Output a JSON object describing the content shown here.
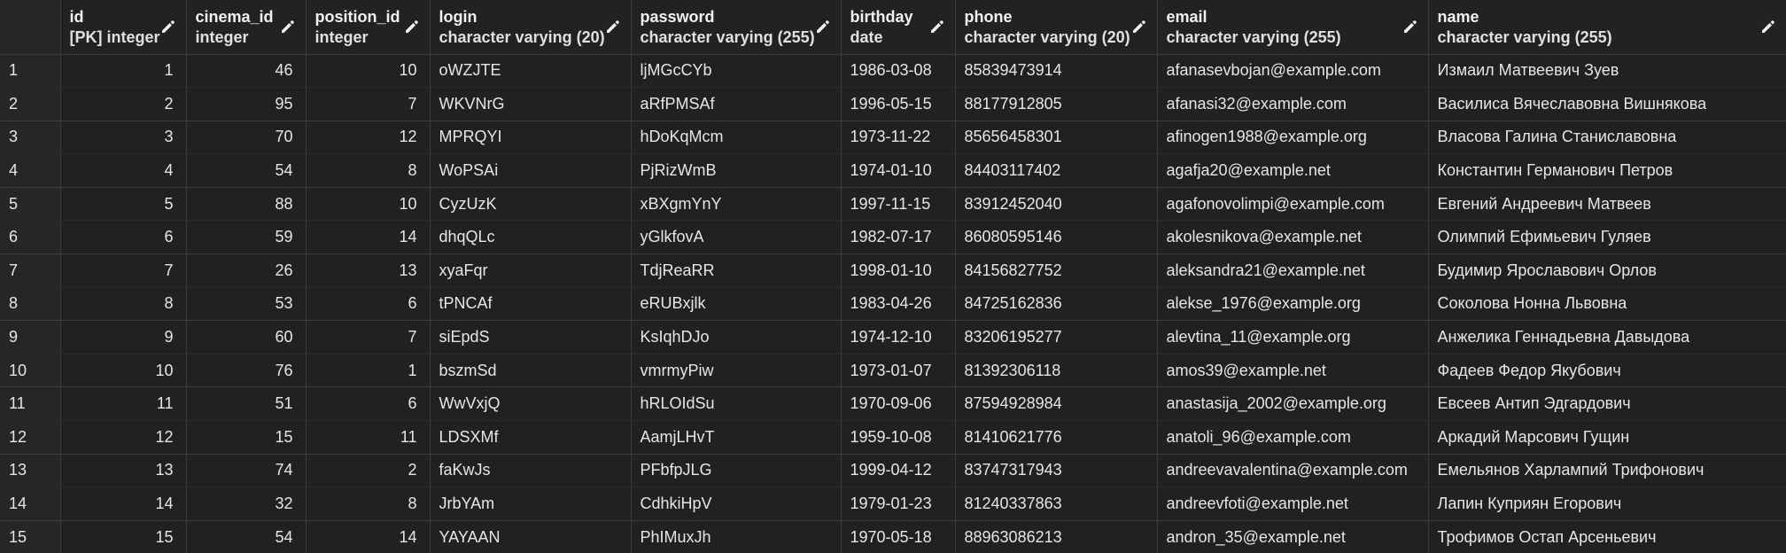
{
  "columns": [
    {
      "key": "rownum",
      "name": "",
      "type": ""
    },
    {
      "key": "id",
      "name": "id",
      "type": "[PK] integer"
    },
    {
      "key": "cinema_id",
      "name": "cinema_id",
      "type": "integer"
    },
    {
      "key": "position_id",
      "name": "position_id",
      "type": "integer"
    },
    {
      "key": "login",
      "name": "login",
      "type": "character varying (20)"
    },
    {
      "key": "password",
      "name": "password",
      "type": "character varying (255)"
    },
    {
      "key": "birthday",
      "name": "birthday",
      "type": "date"
    },
    {
      "key": "phone",
      "name": "phone",
      "type": "character varying (20)"
    },
    {
      "key": "email",
      "name": "email",
      "type": "character varying (255)"
    },
    {
      "key": "name",
      "name": "name",
      "type": "character varying (255)"
    }
  ],
  "rows": [
    {
      "rownum": "1",
      "id": "1",
      "cinema_id": "46",
      "position_id": "10",
      "login": "oWZJTE",
      "password": "ljMGcCYb",
      "birthday": "1986-03-08",
      "phone": "85839473914",
      "email": "afanasevbojan@example.com",
      "name": "Измаил Матвеевич Зуев"
    },
    {
      "rownum": "2",
      "id": "2",
      "cinema_id": "95",
      "position_id": "7",
      "login": "WKVNrG",
      "password": "aRfPMSAf",
      "birthday": "1996-05-15",
      "phone": "88177912805",
      "email": "afanasi32@example.com",
      "name": "Василиса Вячеславовна Вишнякова"
    },
    {
      "rownum": "3",
      "id": "3",
      "cinema_id": "70",
      "position_id": "12",
      "login": "MPRQYI",
      "password": "hDoKqMcm",
      "birthday": "1973-11-22",
      "phone": "85656458301",
      "email": "afinogen1988@example.org",
      "name": "Власова Галина Станиславовна"
    },
    {
      "rownum": "4",
      "id": "4",
      "cinema_id": "54",
      "position_id": "8",
      "login": "WoPSAi",
      "password": "PjRizWmB",
      "birthday": "1974-01-10",
      "phone": "84403117402",
      "email": "agafja20@example.net",
      "name": "Константин Германович Петров"
    },
    {
      "rownum": "5",
      "id": "5",
      "cinema_id": "88",
      "position_id": "10",
      "login": "CyzUzK",
      "password": "xBXgmYnY",
      "birthday": "1997-11-15",
      "phone": "83912452040",
      "email": "agafonovolimpi@example.com",
      "name": "Евгений Андреевич Матвеев"
    },
    {
      "rownum": "6",
      "id": "6",
      "cinema_id": "59",
      "position_id": "14",
      "login": "dhqQLc",
      "password": "yGlkfovA",
      "birthday": "1982-07-17",
      "phone": "86080595146",
      "email": "akolesnikova@example.net",
      "name": "Олимпий Ефимьевич Гуляев"
    },
    {
      "rownum": "7",
      "id": "7",
      "cinema_id": "26",
      "position_id": "13",
      "login": "xyaFqr",
      "password": "TdjReaRR",
      "birthday": "1998-01-10",
      "phone": "84156827752",
      "email": "aleksandra21@example.net",
      "name": "Будимир Ярославович Орлов"
    },
    {
      "rownum": "8",
      "id": "8",
      "cinema_id": "53",
      "position_id": "6",
      "login": "tPNCAf",
      "password": "eRUBxjlk",
      "birthday": "1983-04-26",
      "phone": "84725162836",
      "email": "alekse_1976@example.org",
      "name": "Соколова Нонна Львовна"
    },
    {
      "rownum": "9",
      "id": "9",
      "cinema_id": "60",
      "position_id": "7",
      "login": "siEpdS",
      "password": "KsIqhDJo",
      "birthday": "1974-12-10",
      "phone": "83206195277",
      "email": "alevtina_11@example.org",
      "name": "Анжелика Геннадьевна Давыдова"
    },
    {
      "rownum": "10",
      "id": "10",
      "cinema_id": "76",
      "position_id": "1",
      "login": "bszmSd",
      "password": "vmrmyPiw",
      "birthday": "1973-01-07",
      "phone": "81392306118",
      "email": "amos39@example.net",
      "name": "Фадеев Федор Якубович"
    },
    {
      "rownum": "11",
      "id": "11",
      "cinema_id": "51",
      "position_id": "6",
      "login": "WwVxjQ",
      "password": "hRLOIdSu",
      "birthday": "1970-09-06",
      "phone": "87594928984",
      "email": "anastasija_2002@example.org",
      "name": "Евсеев Антип Эдгардович"
    },
    {
      "rownum": "12",
      "id": "12",
      "cinema_id": "15",
      "position_id": "11",
      "login": "LDSXMf",
      "password": "AamjLHvT",
      "birthday": "1959-10-08",
      "phone": "81410621776",
      "email": "anatoli_96@example.com",
      "name": "Аркадий Марсович Гущин"
    },
    {
      "rownum": "13",
      "id": "13",
      "cinema_id": "74",
      "position_id": "2",
      "login": "faKwJs",
      "password": "PFbfpJLG",
      "birthday": "1999-04-12",
      "phone": "83747317943",
      "email": "andreevavalentina@example.com",
      "name": "Емельянов Харлампий Трифонович"
    },
    {
      "rownum": "14",
      "id": "14",
      "cinema_id": "32",
      "position_id": "8",
      "login": "JrbYAm",
      "password": "CdhkiHpV",
      "birthday": "1979-01-23",
      "phone": "81240337863",
      "email": "andreevfoti@example.net",
      "name": "Лапин Куприян Егорович"
    },
    {
      "rownum": "15",
      "id": "15",
      "cinema_id": "54",
      "position_id": "14",
      "login": "YAYAAN",
      "password": "PhIMuxJh",
      "birthday": "1970-05-18",
      "phone": "88963086213",
      "email": "andron_35@example.net",
      "name": "Трофимов Остап Арсеньевич"
    }
  ],
  "icons": {
    "edit": "pencil-icon"
  },
  "colors": {
    "background": "#212121",
    "header": "#222222",
    "gridline": "#3a3a3a",
    "text": "#e6e6e6"
  }
}
